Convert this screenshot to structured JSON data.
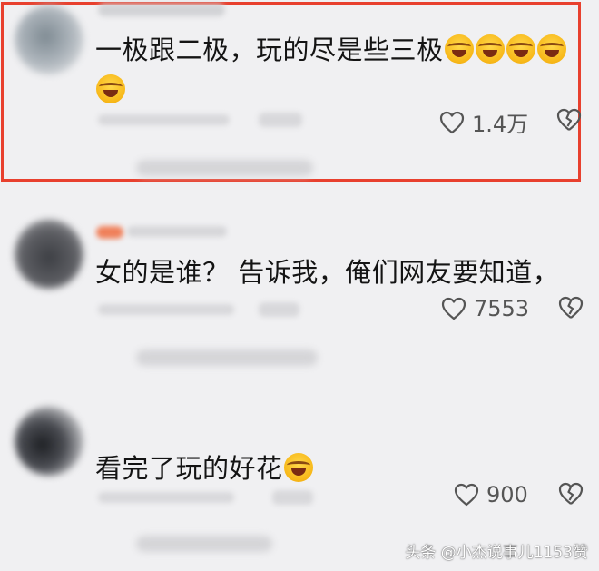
{
  "comments": [
    {
      "text": "一极跟二极，玩的尽是些三极",
      "emoji_count": 5,
      "likes": "1.4万",
      "highlighted": true
    },
    {
      "text": "女的是谁？ 告诉我，俺们网友要知道，",
      "emoji_count": 0,
      "likes": "7553",
      "highlighted": false
    },
    {
      "text": "看完了玩的好花",
      "emoji_count": 1,
      "likes": "900",
      "highlighted": false
    }
  ],
  "icons": {
    "like": "heart-outline-icon",
    "dislike": "broken-heart-icon",
    "emoji": "crying-laughing-emoji-icon"
  },
  "colors": {
    "highlight_border": "#e8402e",
    "background": "#f0f0f2"
  },
  "watermark": "头条 @小杰说事儿1153赞"
}
